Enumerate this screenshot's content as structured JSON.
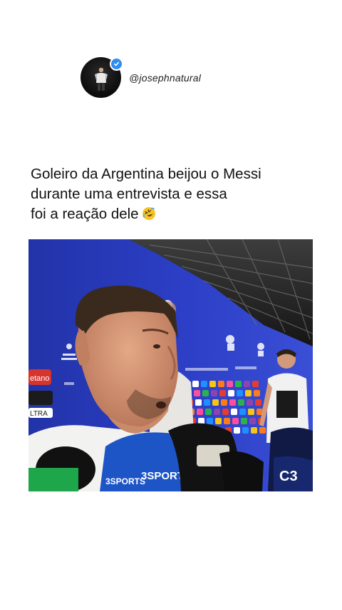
{
  "profile": {
    "handle": "@josephnatural",
    "verified": true
  },
  "caption": {
    "line1": "Goleiro da Argentina beijou o Messi",
    "line2": "durante uma entrevista e essa",
    "line3": "foi a reação dele",
    "emoji": "rolling-on-floor-laughing-icon"
  },
  "video": {
    "mic_labels": [
      "3SPORTS",
      "3SPORTS",
      "C3"
    ],
    "sponsor_labels": [
      "etano",
      "LTRA"
    ]
  },
  "colors": {
    "verified": "#2f8cf1",
    "backdrop": "#1b2a8c"
  }
}
